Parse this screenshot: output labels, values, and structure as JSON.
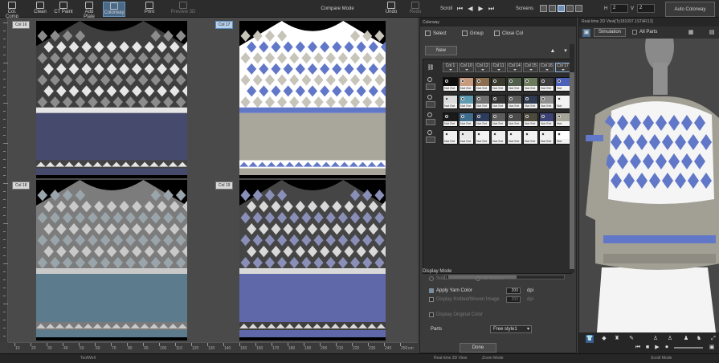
{
  "toolbar": {
    "col_comp": "Col. Comp",
    "clean": "Clean",
    "ct_paint": "CT Paint",
    "add_plate": "Add Plate",
    "colorway": "Colorway",
    "print": "Print",
    "preview_3d": "Preview 3D",
    "compare_mode": "Compare Mode",
    "undo": "Undo",
    "redo": "Redo",
    "scroll": "Scroll",
    "screens": "Screens",
    "h_label": "H",
    "h_value": "2",
    "v_label": "V",
    "v_value": "2",
    "auto_colorway": "Auto Colorway"
  },
  "canvas": {
    "quads": [
      {
        "label": "Col 16",
        "body_color": "#464b6e",
        "yoke_color": "#3e3e3e",
        "fill": "#434343",
        "accent": "#e6e6e6",
        "mid": "#8c8c8c"
      },
      {
        "label": "Col 17",
        "body_color": "#a9a69c",
        "yoke_color": "#ffffff",
        "fill": "#ffffff",
        "accent": "#6177c8",
        "mid": "#c7c4ba"
      },
      {
        "label": "Col 18",
        "body_color": "#5c7c8e",
        "yoke_color": "#7c7c7c",
        "fill": "#7a7a7a",
        "accent": "#c9c9c9",
        "mid": "#9aa5ab"
      },
      {
        "label": "Col 19",
        "body_color": "#5f68a8",
        "yoke_color": "#454545",
        "fill": "#3f3f3f",
        "accent": "#d9d9d9",
        "mid": "#8a8fb8"
      }
    ]
  },
  "ruler": {
    "ticks": [
      "10",
      "20",
      "30",
      "40",
      "50",
      "60",
      "70",
      "80",
      "90",
      "100",
      "110",
      "120",
      "130",
      "140",
      "150",
      "160",
      "170",
      "180",
      "190",
      "200",
      "210",
      "220",
      "230",
      "240",
      "250"
    ],
    "unit": "cm"
  },
  "colorway": {
    "title": "Colorway",
    "select": "Select",
    "group": "Group",
    "close_col": "Close Col",
    "new": "New",
    "columns": [
      "Col 1",
      "Col 10",
      "Col 12",
      "Col 11",
      "Col 14",
      "Col 15",
      "Col 16",
      "Col 17"
    ],
    "rows": [
      [
        {
          "c": "#0d0d0d",
          "t": "Not Ent"
        },
        {
          "c": "#c79a7e",
          "t": "Not Ent"
        },
        {
          "c": "#8c6e4f",
          "t": "Not Ent"
        },
        {
          "c": "#3b3a2e",
          "t": "Not Ent"
        },
        {
          "c": "#4f5f49",
          "t": "Not Ent"
        },
        {
          "c": "#6b7a5a",
          "t": "Not Ent"
        },
        {
          "c": "#3d3d3d",
          "t": "Not Ent"
        },
        {
          "c": "#4b60b8",
          "t": "Not"
        }
      ],
      [
        {
          "c": "#dcdcdc",
          "t": "Not Ent"
        },
        {
          "c": "#5e9bb0",
          "t": "Not Ent"
        },
        {
          "c": "#6f6f6f",
          "t": "Not Ent"
        },
        {
          "c": "#363636",
          "t": "Not Ent"
        },
        {
          "c": "#5d5d5d",
          "t": "Not Ent"
        },
        {
          "c": "#2d3a4f",
          "t": "Not Ent"
        },
        {
          "c": "#8f8f8f",
          "t": "Not Ent"
        },
        {
          "c": "#f3f3f3",
          "t": "Not"
        }
      ],
      [
        {
          "c": "#1a1a1a",
          "t": "Not Ent"
        },
        {
          "c": "#3f6d8e",
          "t": "Not Ent"
        },
        {
          "c": "#2c3c5c",
          "t": "Not Ent"
        },
        {
          "c": "#5c5c5c",
          "t": "Not Ent"
        },
        {
          "c": "#4b4b4b",
          "t": "Not Ent"
        },
        {
          "c": "#4c4a3c",
          "t": "Not Ent"
        },
        {
          "c": "#3c4274",
          "t": "Not Ent"
        },
        {
          "c": "#a7a49a",
          "t": "Not"
        }
      ],
      [
        {
          "c": "#f2f2f2",
          "t": "Not Ent"
        },
        {
          "c": "#e8e8e8",
          "t": "Not Ent"
        },
        {
          "c": "#f2f2f2",
          "t": "Not Ent"
        },
        {
          "c": "#efefef",
          "t": "Not Ent"
        },
        {
          "c": "#f0f0f0",
          "t": "Not Ent"
        },
        {
          "c": "#f2f2f2",
          "t": "Not Ent"
        },
        {
          "c": "#f0f0f0",
          "t": "Not Ent"
        },
        {
          "c": "#ffffff",
          "t": "Not"
        }
      ]
    ]
  },
  "display_mode": {
    "title": "Display Mode",
    "solid": "Solid",
    "all_colors": "All Colors",
    "apply_yarn_color": "Apply Yarn Color",
    "apply_yarn_color_value": "200",
    "display_knitted": "Display Knitted/Woven Image",
    "display_knitted_value": "200",
    "dpi": "dpi",
    "display_original": "Display Original Color",
    "parts_label": "Parts",
    "parts_value": "Free style1",
    "done": "Done"
  },
  "view3d": {
    "title": "Real-time 3D View[Ty181097.1STAR13]",
    "simulation": "Simulation",
    "all_parts": "All Parts",
    "sweater_body": "#a29f95",
    "sweater_pattern": "#6177c8",
    "sweater_light": "#f5f5f5"
  },
  "status": {
    "left": "ToolWell",
    "mid": "Real-time 3D View",
    "zoom": "Zoom Mode",
    "right": "Scroll Mode"
  }
}
